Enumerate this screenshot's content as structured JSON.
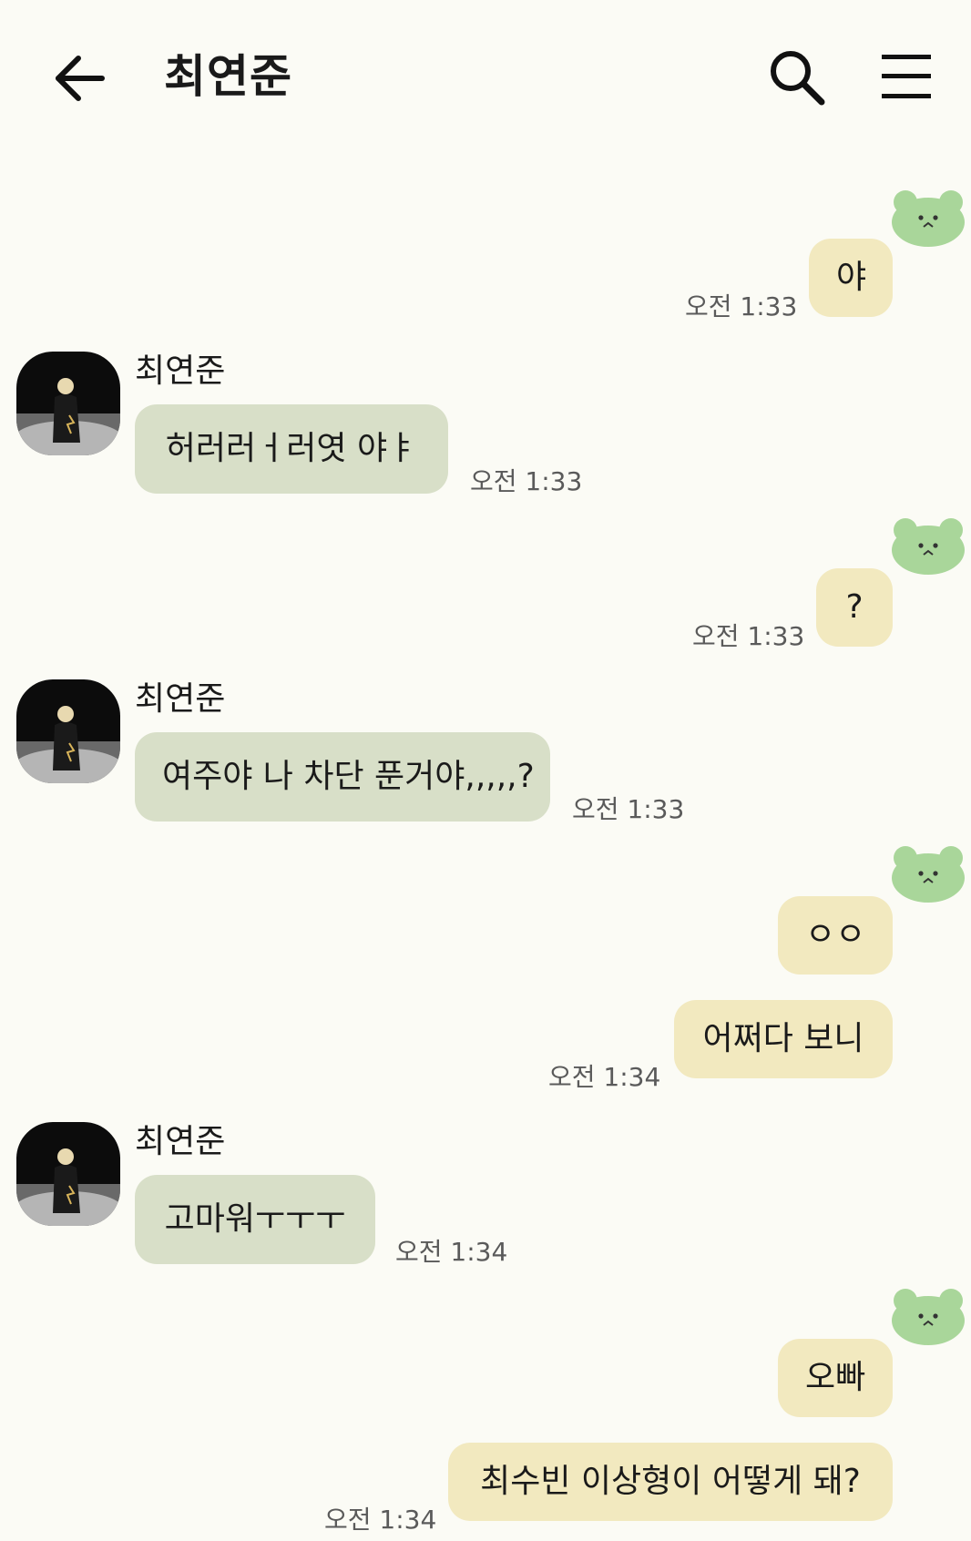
{
  "header": {
    "title": "최연준",
    "back_icon": "arrow-left-icon",
    "search_icon": "search-icon",
    "menu_icon": "menu-icon"
  },
  "colors": {
    "background": "#fbfbf5",
    "my_bubble": "#f2e9bf",
    "their_bubble": "#d8dfc8",
    "sticker": "#a9d69a"
  },
  "messages": [
    {
      "sender": "me",
      "text": "야",
      "time": "오전 1:33"
    },
    {
      "sender": "최연준",
      "text": "허러러ㅓ러엿 야ㅑ",
      "time": "오전 1:33"
    },
    {
      "sender": "me",
      "text": "?",
      "time": "오전 1:33"
    },
    {
      "sender": "최연준",
      "text": "여주야 나 차단 푼거야,,,,,?",
      "time": "오전 1:33"
    },
    {
      "sender": "me",
      "text": "ㅇㅇ",
      "time": ""
    },
    {
      "sender": "me",
      "text": "어쩌다 보니",
      "time": "오전 1:34"
    },
    {
      "sender": "최연준",
      "text": "고마워ㅜㅜㅜ",
      "time": "오전 1:34"
    },
    {
      "sender": "me",
      "text": "오빠",
      "time": ""
    },
    {
      "sender": "me",
      "text": "최수빈 이상형이 어떻게 돼?",
      "time": "오전 1:34"
    }
  ]
}
